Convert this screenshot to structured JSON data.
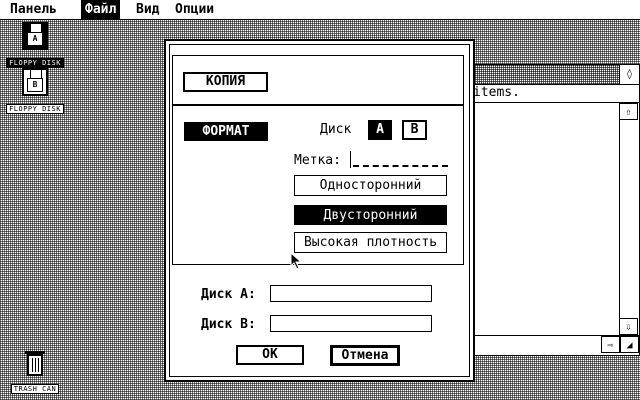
{
  "menubar": {
    "items": [
      {
        "label": "Панель"
      },
      {
        "label": "Файл"
      },
      {
        "label": "Вид"
      },
      {
        "label": "Опции"
      }
    ]
  },
  "desktop": {
    "icons": [
      {
        "drive": "A",
        "caption": "FLOPPY DISK"
      },
      {
        "drive": "B",
        "caption": "FLOPPY DISK"
      },
      {
        "caption": "TRASH CAN"
      }
    ]
  },
  "background_window": {
    "info_text": "items.",
    "fuller_glyph": "◊",
    "scroll_up": "⇧",
    "scroll_down": "⇩",
    "scroll_right": "⇨",
    "size_glyph": "◢"
  },
  "dialog": {
    "copy_button": "КОПИЯ",
    "format_button": "ФОРМАТ",
    "disk_label": "Диск",
    "drive_a": "A",
    "drive_b": "B",
    "meta_label": "Метка:",
    "single_sided": "Односторонний",
    "double_sided": "Двусторонний",
    "high_density": "Высокая плотность",
    "disk_a_label": "Диск A:",
    "disk_a_value": "",
    "disk_b_label": "Диск B:",
    "disk_b_value": "",
    "ok": "OK",
    "cancel": "Отмена"
  }
}
